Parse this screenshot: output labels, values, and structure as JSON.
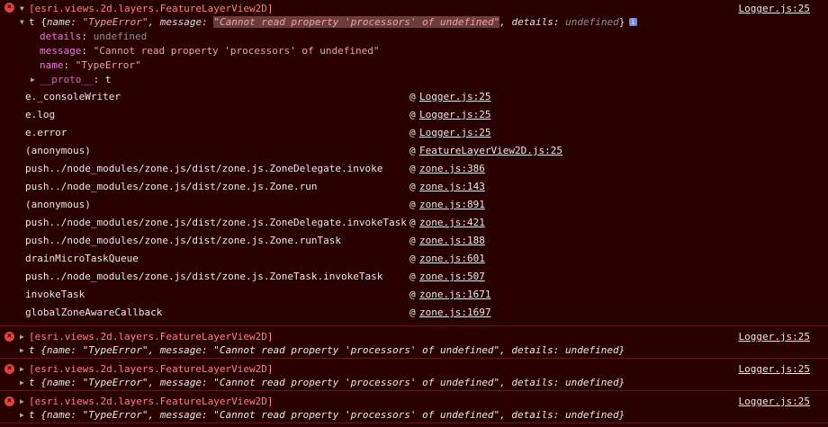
{
  "console": {
    "expanded": {
      "tag": "[esri.views.2d.layers.FeatureLayerView2D]",
      "source": "Logger.js:25",
      "summary": {
        "prefix": "t {",
        "name_key": "name",
        "name_val": "\"TypeError\"",
        "message_key": "message",
        "message_val": "\"Cannot read property 'processors' of undefined\"",
        "details_key": "details",
        "details_val": "undefined",
        "suffix": "}"
      },
      "props": [
        {
          "key": "details",
          "value": "undefined"
        },
        {
          "key": "message",
          "value": "\"Cannot read property 'processors' of undefined\""
        },
        {
          "key": "name",
          "value": "\"TypeError\""
        }
      ],
      "proto": {
        "key": "__proto__",
        "value": "t"
      },
      "stack": [
        {
          "fn": "e._consoleWriter",
          "src": "Logger.js:25"
        },
        {
          "fn": "e.log",
          "src": "Logger.js:25"
        },
        {
          "fn": "e.error",
          "src": "Logger.js:25"
        },
        {
          "fn": "(anonymous)",
          "src": "FeatureLayerView2D.js:25"
        },
        {
          "fn": "push../node_modules/zone.js/dist/zone.js.ZoneDelegate.invoke",
          "src": "zone.js:386"
        },
        {
          "fn": "push../node_modules/zone.js/dist/zone.js.Zone.run",
          "src": "zone.js:143"
        },
        {
          "fn": "(anonymous)",
          "src": "zone.js:891"
        },
        {
          "fn": "push../node_modules/zone.js/dist/zone.js.ZoneDelegate.invokeTask",
          "src": "zone.js:421"
        },
        {
          "fn": "push../node_modules/zone.js/dist/zone.js.Zone.runTask",
          "src": "zone.js:188"
        },
        {
          "fn": "drainMicroTaskQueue",
          "src": "zone.js:601"
        },
        {
          "fn": "push../node_modules/zone.js/dist/zone.js.ZoneTask.invokeTask",
          "src": "zone.js:507"
        },
        {
          "fn": "invokeTask",
          "src": "zone.js:1671"
        },
        {
          "fn": "globalZoneAwareCallback",
          "src": "zone.js:1697"
        }
      ],
      "at": "@"
    },
    "collapsed": [
      {
        "tag": "[esri.views.2d.layers.FeatureLayerView2D]",
        "source": "Logger.js:25",
        "line": "t {name: \"TypeError\", message: \"Cannot read property 'processors' of undefined\", details: undefined}"
      },
      {
        "tag": "[esri.views.2d.layers.FeatureLayerView2D]",
        "source": "Logger.js:25",
        "line": "t {name: \"TypeError\", message: \"Cannot read property 'processors' of undefined\", details: undefined}"
      },
      {
        "tag": "[esri.views.2d.layers.FeatureLayerView2D]",
        "source": "Logger.js:25",
        "line": "t {name: \"TypeError\", message: \"Cannot read property 'processors' of undefined\", details: undefined}"
      }
    ],
    "icons": {
      "error": "error-circle-icon",
      "info_badge": "info-badge-icon"
    },
    "colors": {
      "background": "#290000",
      "error_text": "#ff8080",
      "key": "#e878e8",
      "icon": "#e0453a"
    }
  }
}
